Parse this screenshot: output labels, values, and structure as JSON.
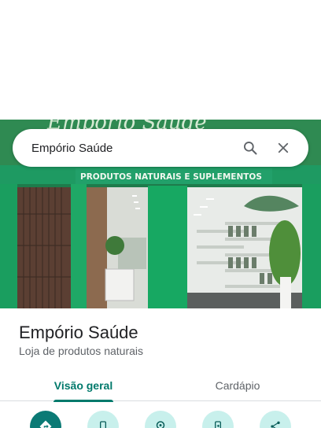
{
  "search": {
    "value": "Empório Saúde"
  },
  "photo": {
    "sign_top_text": "Empório Saúde",
    "sign_banner_text": "PRODUTOS NATURAIS E SUPLEMENTOS"
  },
  "place": {
    "title": "Empório Saúde",
    "category": "Loja de produtos naturais"
  },
  "tabs": [
    {
      "label": "Visão geral",
      "selected": true
    },
    {
      "label": "Cardápio",
      "selected": false
    }
  ],
  "actions": [
    {
      "icon": "directions-icon"
    },
    {
      "icon": "phone-icon"
    },
    {
      "icon": "location-icon"
    },
    {
      "icon": "send-to-phone-icon"
    },
    {
      "icon": "share-icon"
    }
  ],
  "colors": {
    "accent": "#00796b",
    "action_bg": "#c8f0ec",
    "primary_action": "#0b7a75"
  }
}
